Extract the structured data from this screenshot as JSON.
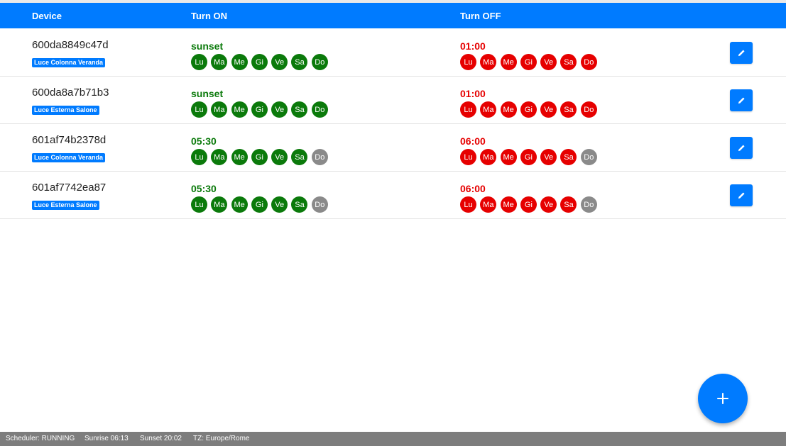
{
  "header": {
    "device": "Device",
    "turn_on": "Turn ON",
    "turn_off": "Turn OFF"
  },
  "rows": [
    {
      "device_id": "600da8849c47d",
      "label": "Luce Colonna Veranda",
      "on_time": "sunset",
      "on_days": [
        {
          "label": "Lu",
          "active": true
        },
        {
          "label": "Ma",
          "active": true
        },
        {
          "label": "Me",
          "active": true
        },
        {
          "label": "Gi",
          "active": true
        },
        {
          "label": "Ve",
          "active": true
        },
        {
          "label": "Sa",
          "active": true
        },
        {
          "label": "Do",
          "active": true
        }
      ],
      "off_time": "01:00",
      "off_days": [
        {
          "label": "Lu",
          "active": true
        },
        {
          "label": "Ma",
          "active": true
        },
        {
          "label": "Me",
          "active": true
        },
        {
          "label": "Gi",
          "active": true
        },
        {
          "label": "Ve",
          "active": true
        },
        {
          "label": "Sa",
          "active": true
        },
        {
          "label": "Do",
          "active": true
        }
      ]
    },
    {
      "device_id": "600da8a7b71b3",
      "label": "Luce Esterna Salone",
      "on_time": "sunset",
      "on_days": [
        {
          "label": "Lu",
          "active": true
        },
        {
          "label": "Ma",
          "active": true
        },
        {
          "label": "Me",
          "active": true
        },
        {
          "label": "Gi",
          "active": true
        },
        {
          "label": "Ve",
          "active": true
        },
        {
          "label": "Sa",
          "active": true
        },
        {
          "label": "Do",
          "active": true
        }
      ],
      "off_time": "01:00",
      "off_days": [
        {
          "label": "Lu",
          "active": true
        },
        {
          "label": "Ma",
          "active": true
        },
        {
          "label": "Me",
          "active": true
        },
        {
          "label": "Gi",
          "active": true
        },
        {
          "label": "Ve",
          "active": true
        },
        {
          "label": "Sa",
          "active": true
        },
        {
          "label": "Do",
          "active": true
        }
      ]
    },
    {
      "device_id": "601af74b2378d",
      "label": "Luce Colonna Veranda",
      "on_time": "05:30",
      "on_days": [
        {
          "label": "Lu",
          "active": true
        },
        {
          "label": "Ma",
          "active": true
        },
        {
          "label": "Me",
          "active": true
        },
        {
          "label": "Gi",
          "active": true
        },
        {
          "label": "Ve",
          "active": true
        },
        {
          "label": "Sa",
          "active": true
        },
        {
          "label": "Do",
          "active": false
        }
      ],
      "off_time": "06:00",
      "off_days": [
        {
          "label": "Lu",
          "active": true
        },
        {
          "label": "Ma",
          "active": true
        },
        {
          "label": "Me",
          "active": true
        },
        {
          "label": "Gi",
          "active": true
        },
        {
          "label": "Ve",
          "active": true
        },
        {
          "label": "Sa",
          "active": true
        },
        {
          "label": "Do",
          "active": false
        }
      ]
    },
    {
      "device_id": "601af7742ea87",
      "label": "Luce Esterna Salone",
      "on_time": "05:30",
      "on_days": [
        {
          "label": "Lu",
          "active": true
        },
        {
          "label": "Ma",
          "active": true
        },
        {
          "label": "Me",
          "active": true
        },
        {
          "label": "Gi",
          "active": true
        },
        {
          "label": "Ve",
          "active": true
        },
        {
          "label": "Sa",
          "active": true
        },
        {
          "label": "Do",
          "active": false
        }
      ],
      "off_time": "06:00",
      "off_days": [
        {
          "label": "Lu",
          "active": true
        },
        {
          "label": "Ma",
          "active": true
        },
        {
          "label": "Me",
          "active": true
        },
        {
          "label": "Gi",
          "active": true
        },
        {
          "label": "Ve",
          "active": true
        },
        {
          "label": "Sa",
          "active": true
        },
        {
          "label": "Do",
          "active": false
        }
      ]
    }
  ],
  "status": {
    "scheduler": "Scheduler: RUNNING",
    "sunrise": "Sunrise 06:13",
    "sunset": "Sunset 20:02",
    "tz": "TZ: Europe/Rome"
  },
  "icons": {
    "edit": "pencil-icon",
    "add": "plus-icon"
  },
  "colors": {
    "accent": "#007bff",
    "on": "#0b7a0b",
    "off": "#e60000",
    "inactive": "#8a8a8a",
    "statusbar": "#7d7d7d"
  }
}
